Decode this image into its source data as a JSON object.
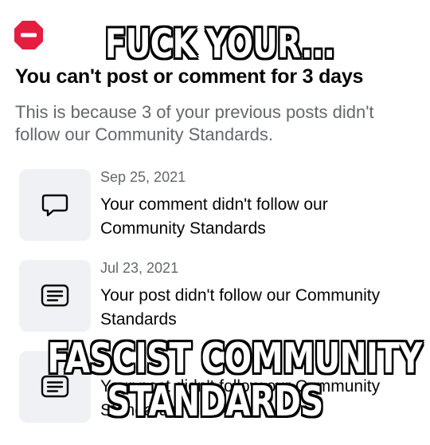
{
  "restriction": {
    "icon": "stop-icon",
    "accent_color": "#e41e3f",
    "title": "You can't post or comment for 3 days",
    "description": "This is because 3 of your previous posts didn't follow our Community Standards."
  },
  "violations": [
    {
      "icon": "comment-bubble-icon",
      "date": "Sep 25, 2021",
      "message": "Your comment didn't follow our Community Standards"
    },
    {
      "icon": "post-lines-icon",
      "date": "Jul 23, 2021",
      "message": "Your post didn't follow our Community Standards"
    },
    {
      "icon": "post-lines-icon",
      "date": "",
      "message": "Your post didn't follow our Community Standards"
    }
  ],
  "meme_caption": {
    "top": "FUCK YOUR...",
    "bottom_line1": "FASCIST COMMUNITY",
    "bottom_line2": "STANDARDS"
  }
}
